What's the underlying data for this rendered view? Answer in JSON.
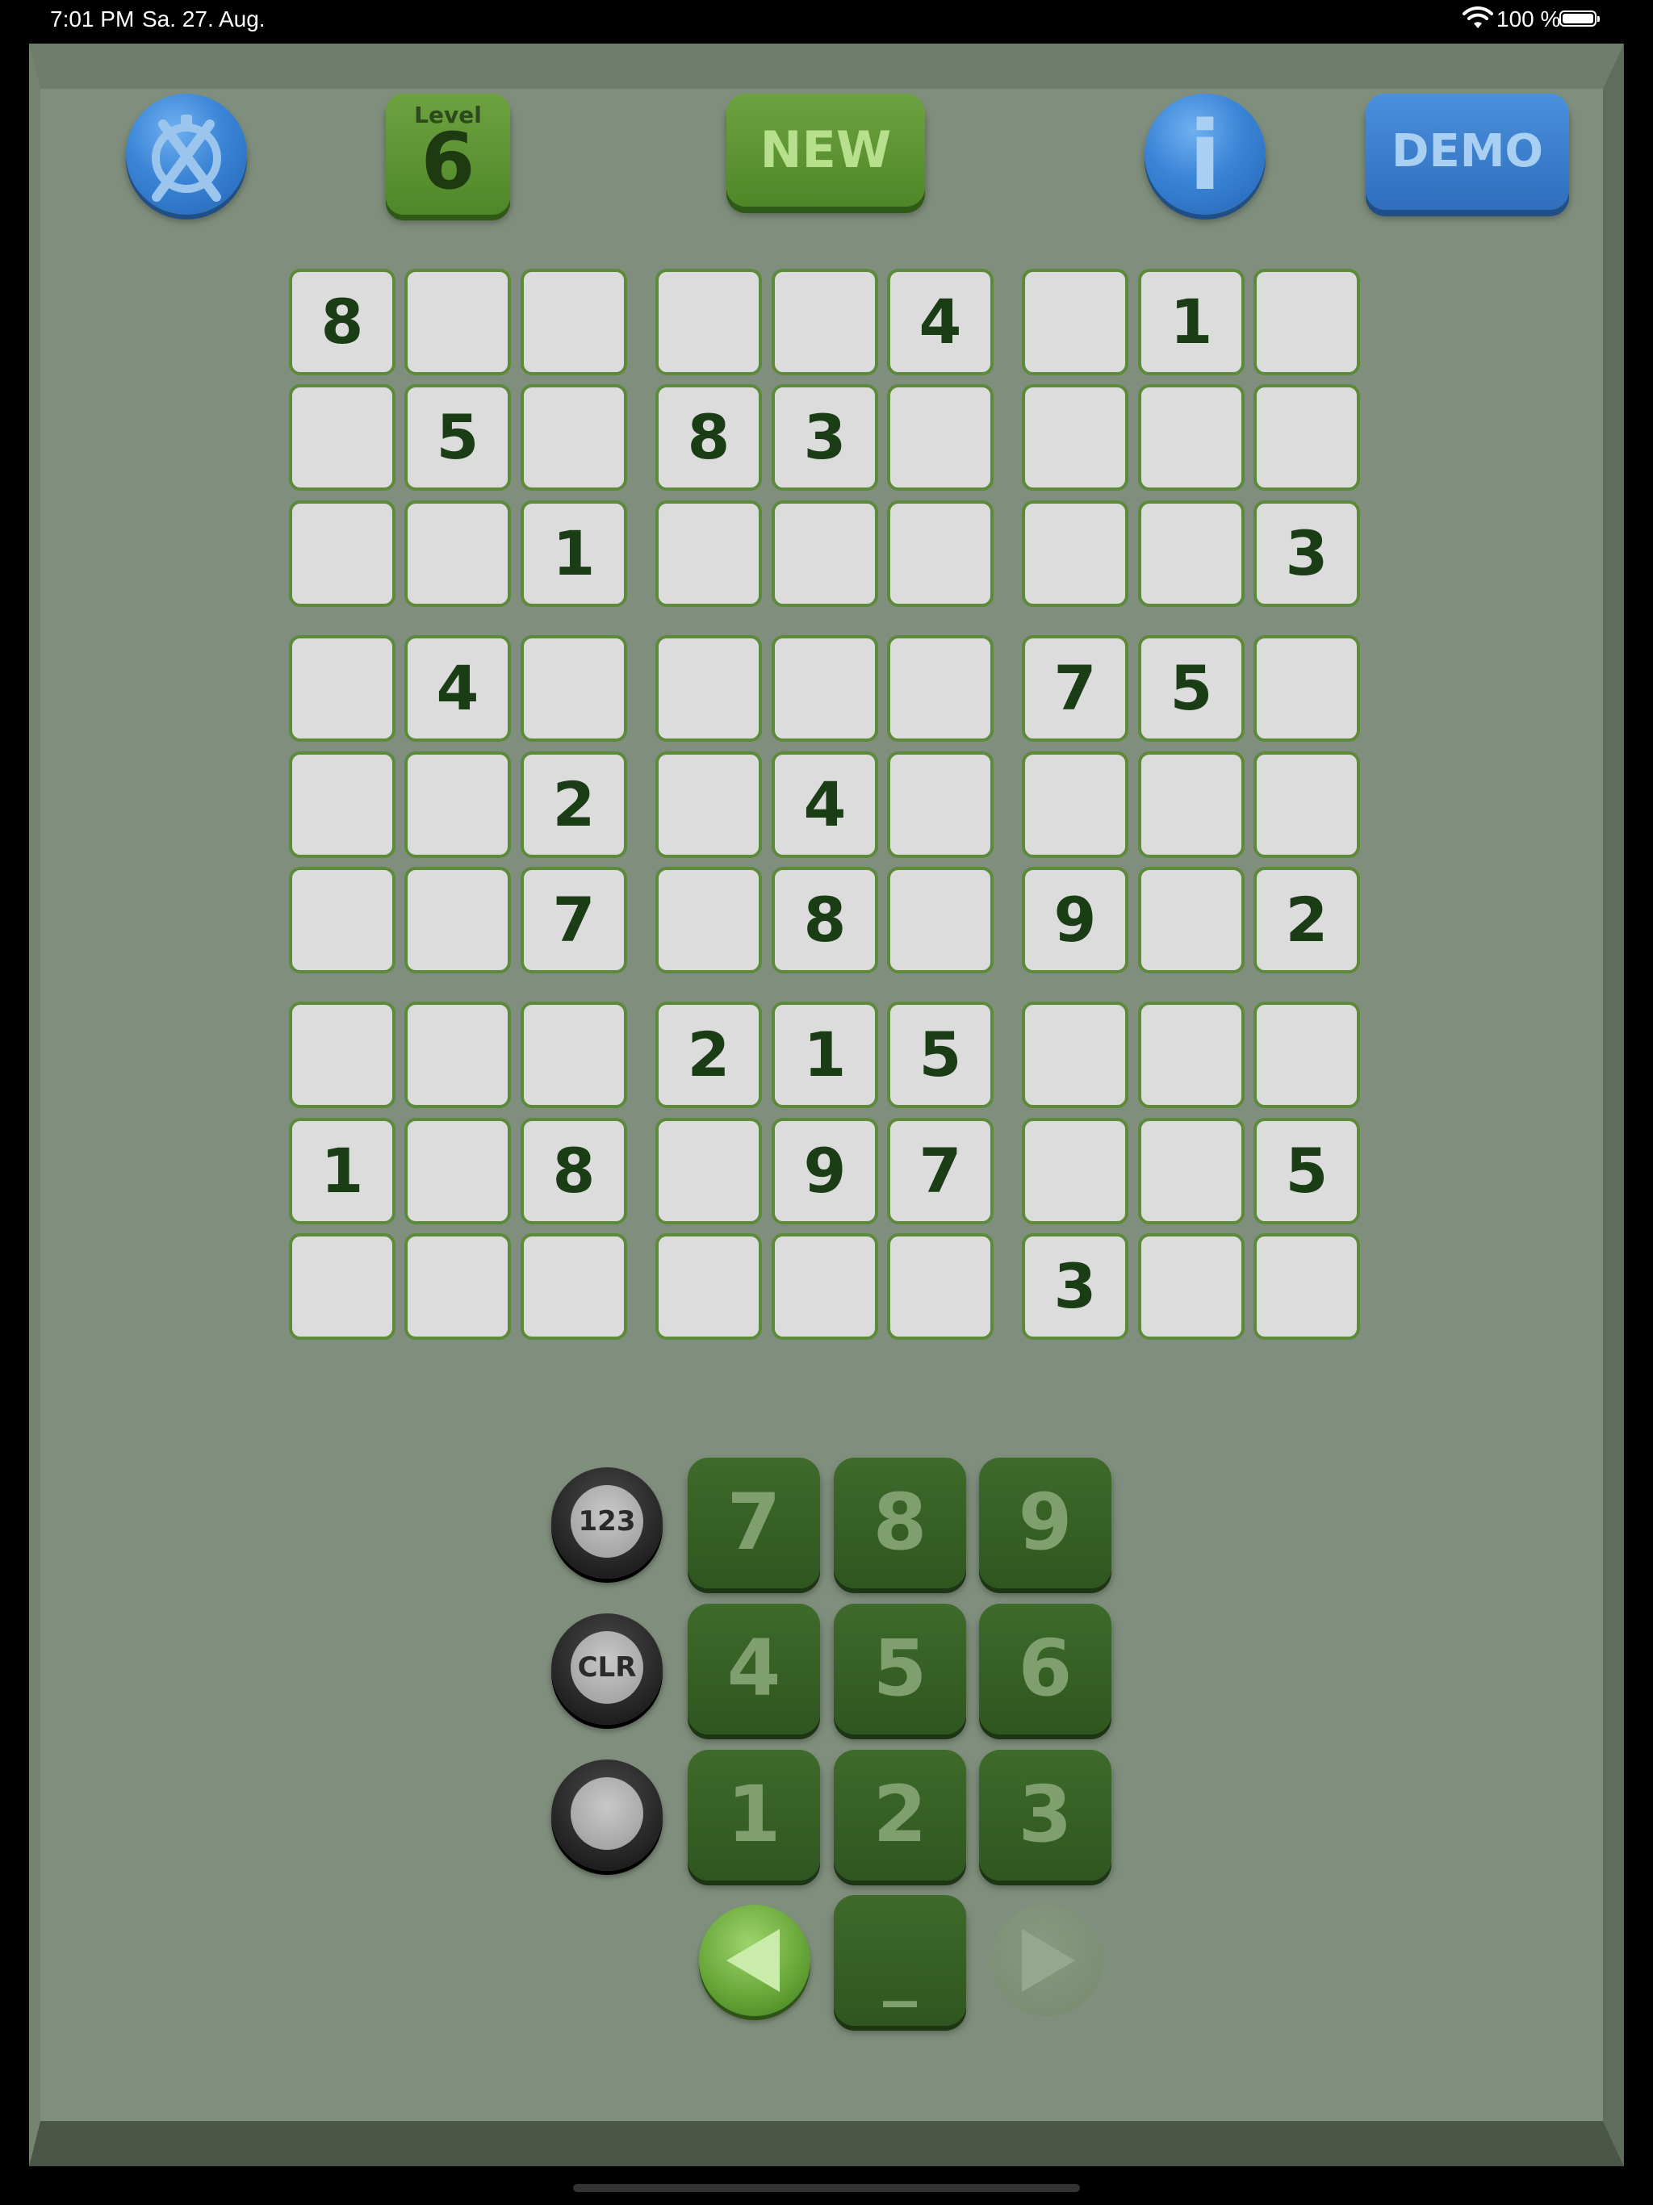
{
  "status": {
    "time": "7:01 PM",
    "date": "Sa. 27. Aug.",
    "battery_pct": "100 %",
    "wifi_icon": "wifi-icon",
    "battery_icon": "battery-icon"
  },
  "toolbar": {
    "timer_icon": "stopwatch-crossed-icon",
    "level_label": "Level",
    "level_value": "6",
    "new_label": "NEW",
    "info_label": "i",
    "demo_label": "DEMO"
  },
  "puzzle": {
    "rows": [
      [
        "8",
        "",
        "",
        "",
        "",
        "4",
        "",
        "1",
        ""
      ],
      [
        "",
        "5",
        "",
        "8",
        "3",
        "",
        "",
        "",
        ""
      ],
      [
        "",
        "",
        "1",
        "",
        "",
        "",
        "",
        "",
        "3"
      ],
      [
        "",
        "4",
        "",
        "",
        "",
        "",
        "7",
        "5",
        ""
      ],
      [
        "",
        "",
        "2",
        "",
        "4",
        "",
        "",
        "",
        ""
      ],
      [
        "",
        "",
        "7",
        "",
        "8",
        "",
        "9",
        "",
        "2"
      ],
      [
        "",
        "",
        "",
        "2",
        "1",
        "5",
        "",
        "",
        ""
      ],
      [
        "1",
        "",
        "8",
        "",
        "9",
        "7",
        "",
        "",
        "5"
      ],
      [
        "",
        "",
        "",
        "",
        "",
        "",
        "3",
        "",
        ""
      ]
    ]
  },
  "keypad": {
    "numbers": [
      "7",
      "8",
      "9",
      "4",
      "5",
      "6",
      "1",
      "2",
      "3"
    ],
    "mode_label": "123",
    "clear_label": "CLR",
    "blank_label": "_",
    "undo_icon": "arrow-left-icon",
    "redo_icon": "arrow-right-icon",
    "record_icon": "circle-icon"
  },
  "colors": {
    "board": "#808f7d",
    "cell_fill": "#dcdcdc",
    "cell_border": "#5c8a3a",
    "digit": "#1b3d16",
    "green_button": "#4f8728",
    "blue_button": "#2f6fbd",
    "pad_key": "#2f5620"
  }
}
